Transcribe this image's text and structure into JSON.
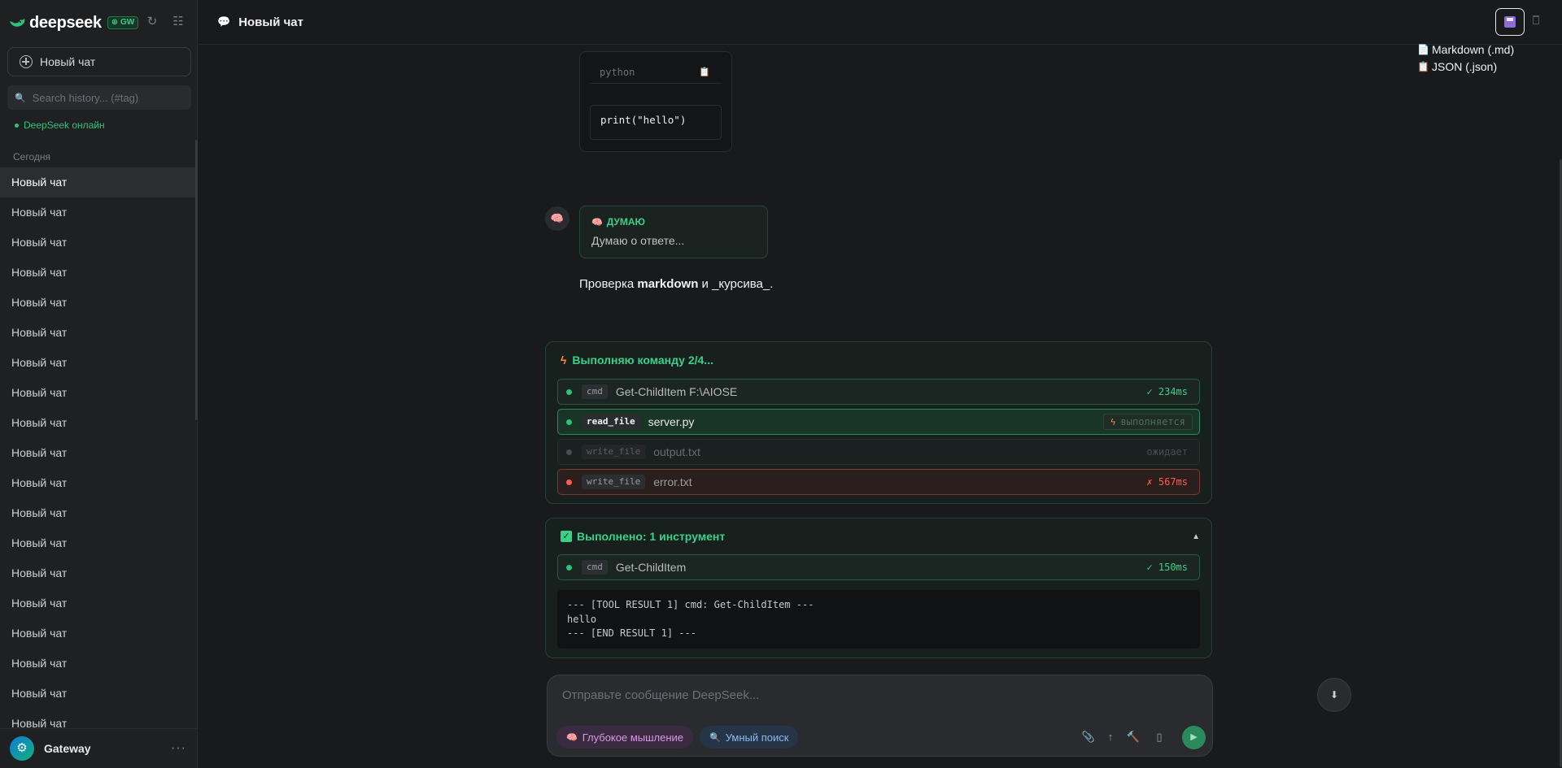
{
  "sidebar": {
    "brand": "deepseek",
    "gw_badge": "GW",
    "new_chat_label": "Новый чат",
    "search_placeholder": "Search history... (#tag)",
    "status": "DeepSeek онлайн",
    "group_label": "Сегодня",
    "items": [
      "Новый чат",
      "Новый чат",
      "Новый чат",
      "Новый чат",
      "Новый чат",
      "Новый чат",
      "Новый чат",
      "Новый чат",
      "Новый чат",
      "Новый чат",
      "Новый чат",
      "Новый чат",
      "Новый чат",
      "Новый чат",
      "Новый чат",
      "Новый чат",
      "Новый чат",
      "Новый чат",
      "Новый чат"
    ],
    "footer_name": "Gateway",
    "footer_more": "···"
  },
  "header": {
    "title": "Новый чат",
    "export_options": [
      "Markdown (.md)",
      "JSON (.json)"
    ]
  },
  "messages": {
    "code": {
      "lang": "python",
      "body": "print(\"hello\")"
    },
    "thinking": {
      "label": "ДУМАЮ",
      "text": "Думаю о ответе..."
    },
    "reply": {
      "before": "Проверка ",
      "bold": "markdown",
      "after": " и _курсива_."
    }
  },
  "execution": {
    "title": "Выполняю команду 2/4...",
    "tools": [
      {
        "tag": "cmd",
        "arg": "Get-ChildItem F:\\AIOSE",
        "status": "✓ 234ms"
      },
      {
        "tag": "read_file",
        "arg": "server.py",
        "status": "выполняется"
      },
      {
        "tag": "write_file",
        "arg": "output.txt",
        "status": "ожидает"
      },
      {
        "tag": "write_file",
        "arg": "error.txt",
        "status": "✗ 567ms"
      }
    ]
  },
  "done": {
    "title": "Выполнено: 1 инструмент",
    "tool": {
      "tag": "cmd",
      "arg": "Get-ChildItem",
      "status": "✓ 150ms"
    },
    "result": "--- [TOOL RESULT 1] cmd: Get-ChildItem ---\nhello\n--- [END RESULT 1] ---"
  },
  "composer": {
    "placeholder": "Отправьте сообщение DeepSeek...",
    "deep_think": "Глубокое мышление",
    "smart_search": "Умный поиск"
  },
  "colors": {
    "accent_green": "#3bd08a",
    "error_red": "#ff5a52",
    "bolt_orange": "#ff8a3d",
    "background": "#191a1c"
  }
}
